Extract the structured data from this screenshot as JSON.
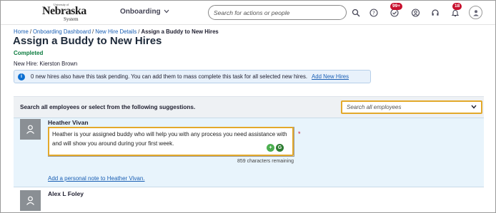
{
  "header": {
    "logo": {
      "small": "University of",
      "name": "Nebraska",
      "sub": "System"
    },
    "module": "Onboarding",
    "search_placeholder": "Search for actions or people",
    "badges": {
      "approvals": "99+",
      "notifications": "18"
    }
  },
  "breadcrumb": {
    "items": [
      "Home",
      "Onboarding Dashboard",
      "New Hire Details"
    ],
    "current": "Assign a Buddy to New Hires"
  },
  "page": {
    "title": "Assign a Buddy to New Hires",
    "status": "Completed",
    "new_hire": "New Hire: Kierston Brown"
  },
  "info_banner": {
    "text": "0 new hires also have this task pending. You can add them to mass complete this task for all selected new hires.",
    "link": "Add New Hires"
  },
  "search_section": {
    "label": "Search all employees or select from the following suggestions.",
    "select_placeholder": "Search all employees"
  },
  "suggestions": [
    {
      "name": "Heather Vivan",
      "note": "Heather is your assigned buddy who will help you with any process you need assistance with and will show you around during your first week.",
      "chars_remaining": "859 characters remaining",
      "add_note_link": "Add a personal note to Heather Vivan."
    },
    {
      "name": "Alex L Foley"
    }
  ],
  "colors": {
    "accent": "#1a5fb4",
    "highlight": "#e3a92b",
    "status": "#0b7b3e",
    "badge": "#c8102e"
  }
}
